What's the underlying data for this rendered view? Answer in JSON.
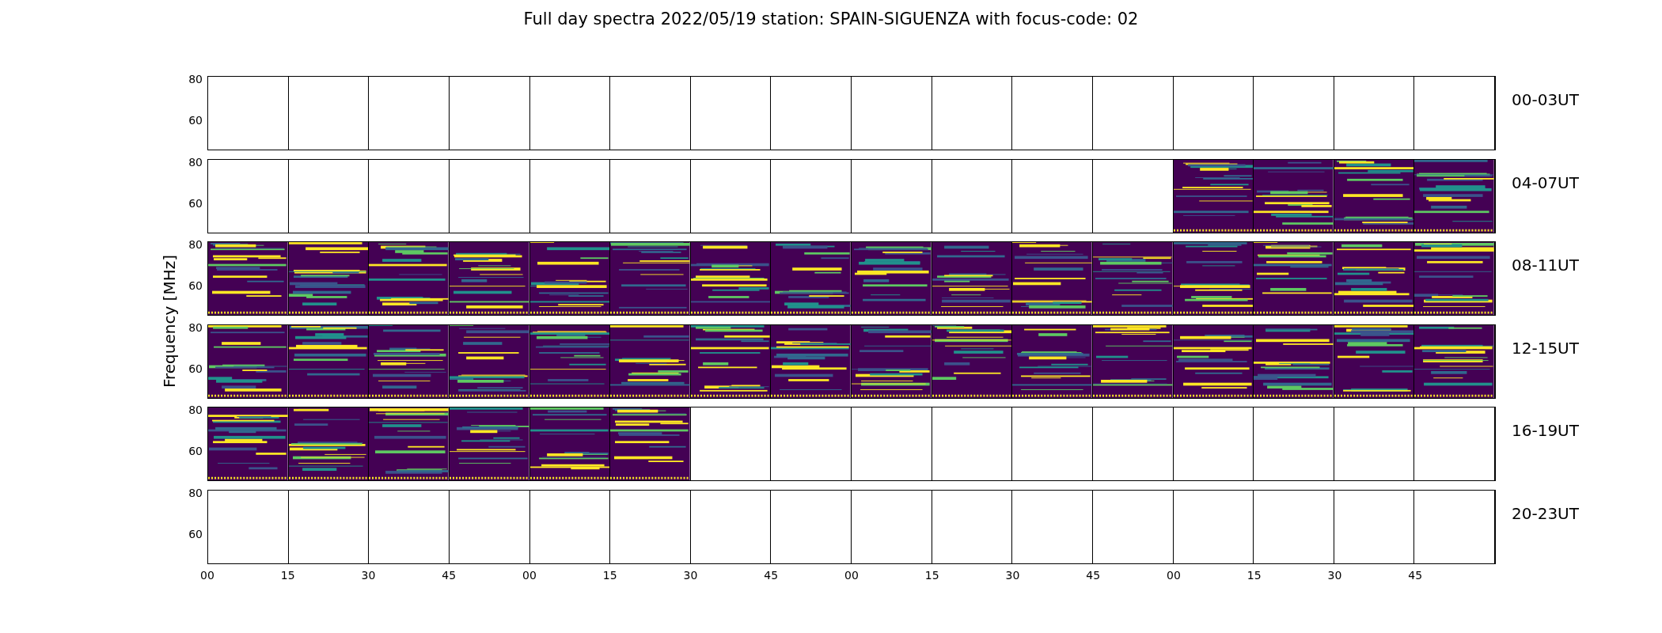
{
  "title": "Full day spectra 2022/05/19 station: SPAIN-SIGUENZA with focus-code: 02",
  "ylabel": "Frequency [MHz]",
  "rows": [
    {
      "label": "00-03UT",
      "yticks": [
        "80",
        "60"
      ],
      "panels": [
        {
          "filled": false
        },
        {
          "filled": false
        },
        {
          "filled": false
        },
        {
          "filled": false
        },
        {
          "filled": false
        },
        {
          "filled": false
        },
        {
          "filled": false
        },
        {
          "filled": false
        },
        {
          "filled": false
        },
        {
          "filled": false
        },
        {
          "filled": false
        },
        {
          "filled": false
        },
        {
          "filled": false
        },
        {
          "filled": false
        },
        {
          "filled": false
        },
        {
          "filled": false
        }
      ]
    },
    {
      "label": "04-07UT",
      "yticks": [
        "80",
        "60"
      ],
      "panels": [
        {
          "filled": false
        },
        {
          "filled": false
        },
        {
          "filled": false
        },
        {
          "filled": false
        },
        {
          "filled": false
        },
        {
          "filled": false
        },
        {
          "filled": false
        },
        {
          "filled": false
        },
        {
          "filled": false
        },
        {
          "filled": false
        },
        {
          "filled": false
        },
        {
          "filled": false
        },
        {
          "filled": true
        },
        {
          "filled": true
        },
        {
          "filled": true
        },
        {
          "filled": true
        }
      ]
    },
    {
      "label": "08-11UT",
      "yticks": [
        "80",
        "60"
      ],
      "panels": [
        {
          "filled": true
        },
        {
          "filled": true
        },
        {
          "filled": true
        },
        {
          "filled": true
        },
        {
          "filled": true
        },
        {
          "filled": true
        },
        {
          "filled": true
        },
        {
          "filled": true
        },
        {
          "filled": true
        },
        {
          "filled": true
        },
        {
          "filled": true
        },
        {
          "filled": true
        },
        {
          "filled": true
        },
        {
          "filled": true
        },
        {
          "filled": true
        },
        {
          "filled": true
        }
      ]
    },
    {
      "label": "12-15UT",
      "yticks": [
        "80",
        "60"
      ],
      "panels": [
        {
          "filled": true
        },
        {
          "filled": true
        },
        {
          "filled": true
        },
        {
          "filled": true
        },
        {
          "filled": true
        },
        {
          "filled": true
        },
        {
          "filled": true
        },
        {
          "filled": true
        },
        {
          "filled": true
        },
        {
          "filled": true
        },
        {
          "filled": true
        },
        {
          "filled": true
        },
        {
          "filled": true
        },
        {
          "filled": true
        },
        {
          "filled": true
        },
        {
          "filled": true
        }
      ]
    },
    {
      "label": "16-19UT",
      "yticks": [
        "80",
        "60"
      ],
      "panels": [
        {
          "filled": true
        },
        {
          "filled": true
        },
        {
          "filled": true
        },
        {
          "filled": true
        },
        {
          "filled": true
        },
        {
          "filled": true
        },
        {
          "filled": false
        },
        {
          "filled": false
        },
        {
          "filled": false
        },
        {
          "filled": false
        },
        {
          "filled": false
        },
        {
          "filled": false
        },
        {
          "filled": false
        },
        {
          "filled": false
        },
        {
          "filled": false
        },
        {
          "filled": false
        }
      ]
    },
    {
      "label": "20-23UT",
      "yticks": [
        "80",
        "60"
      ],
      "panels": [
        {
          "filled": false
        },
        {
          "filled": false
        },
        {
          "filled": false
        },
        {
          "filled": false
        },
        {
          "filled": false
        },
        {
          "filled": false
        },
        {
          "filled": false
        },
        {
          "filled": false
        },
        {
          "filled": false
        },
        {
          "filled": false
        },
        {
          "filled": false
        },
        {
          "filled": false
        },
        {
          "filled": false
        },
        {
          "filled": false
        },
        {
          "filled": false
        },
        {
          "filled": false
        }
      ]
    }
  ],
  "xticks": [
    "00",
    "15",
    "30",
    "45",
    "00",
    "15",
    "30",
    "45",
    "00",
    "15",
    "30",
    "45",
    "00",
    "15",
    "30",
    "45"
  ]
}
